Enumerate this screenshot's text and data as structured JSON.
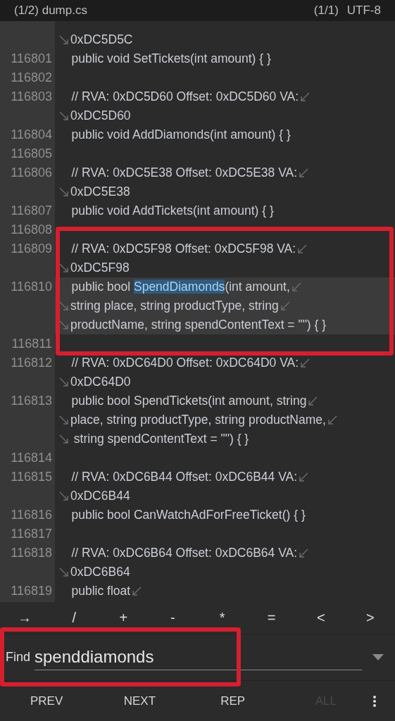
{
  "title_bar": {
    "file": "(1/2) dump.cs",
    "position": "(1/1)",
    "encoding": "UTF-8"
  },
  "lines": [
    {
      "continued": true,
      "wraps": false,
      "current": false,
      "segments": [
        {
          "text": "0xDC5D5C",
          "match": false
        }
      ]
    },
    {
      "number": "116801",
      "continued": false,
      "wraps": false,
      "current": false,
      "segments": [
        {
          "text": "    public void SetTickets(int amount) { }",
          "match": false
        }
      ]
    },
    {
      "number": "116802",
      "continued": false,
      "wraps": false,
      "current": false
    },
    {
      "number": "116803",
      "continued": false,
      "wraps": true,
      "current": false,
      "segments": [
        {
          "text": "    // RVA: 0xDC5D60 Offset: 0xDC5D60 VA:",
          "match": false
        }
      ]
    },
    {
      "continued": true,
      "wraps": false,
      "current": false,
      "segments": [
        {
          "text": "0xDC5D60",
          "match": false
        }
      ]
    },
    {
      "number": "116804",
      "continued": false,
      "wraps": false,
      "current": false,
      "segments": [
        {
          "text": "    public void AddDiamonds(int amount) { }",
          "match": false
        }
      ]
    },
    {
      "number": "116805",
      "continued": false,
      "wraps": false,
      "current": false
    },
    {
      "number": "116806",
      "continued": false,
      "wraps": true,
      "current": false,
      "segments": [
        {
          "text": "    // RVA: 0xDC5E38 Offset: 0xDC5E38 VA:",
          "match": false
        }
      ]
    },
    {
      "continued": true,
      "wraps": false,
      "current": false,
      "segments": [
        {
          "text": "0xDC5E38",
          "match": false
        }
      ]
    },
    {
      "number": "116807",
      "continued": false,
      "wraps": false,
      "current": false,
      "segments": [
        {
          "text": "    public void AddTickets(int amount) { }",
          "match": false
        }
      ]
    },
    {
      "number": "116808",
      "continued": false,
      "wraps": false,
      "current": false
    },
    {
      "number": "116809",
      "continued": false,
      "wraps": true,
      "current": false,
      "segments": [
        {
          "text": "    // RVA: 0xDC5F98 Offset: 0xDC5F98 VA:",
          "match": false
        }
      ]
    },
    {
      "continued": true,
      "wraps": false,
      "current": false,
      "segments": [
        {
          "text": "0xDC5F98",
          "match": false
        }
      ]
    },
    {
      "number": "116810",
      "continued": false,
      "wraps": true,
      "current": true,
      "segments": [
        {
          "text": "    public bool ",
          "match": false
        },
        {
          "text": "SpendDiamonds",
          "match": true
        },
        {
          "text": "(int amount,",
          "match": false
        }
      ]
    },
    {
      "continued": true,
      "wraps": true,
      "current": true,
      "segments": [
        {
          "text": "string place, string productType, string",
          "match": false
        }
      ]
    },
    {
      "continued": true,
      "wraps": false,
      "current": true,
      "segments": [
        {
          "text": "productName, string spendContentText = \"\") { }",
          "match": false
        }
      ]
    },
    {
      "number": "116811",
      "continued": false,
      "wraps": false,
      "current": false
    },
    {
      "number": "116812",
      "continued": false,
      "wraps": true,
      "current": false,
      "segments": [
        {
          "text": "    // RVA: 0xDC64D0 Offset: 0xDC64D0 VA:",
          "match": false
        }
      ]
    },
    {
      "continued": true,
      "wraps": false,
      "current": false,
      "segments": [
        {
          "text": "0xDC64D0",
          "match": false
        }
      ]
    },
    {
      "number": "116813",
      "continued": false,
      "wraps": true,
      "current": false,
      "segments": [
        {
          "text": "    public bool SpendTickets(int amount, string",
          "match": false
        }
      ]
    },
    {
      "continued": true,
      "wraps": true,
      "current": false,
      "segments": [
        {
          "text": "place, string productType, string productName,",
          "match": false
        }
      ]
    },
    {
      "continued": true,
      "wraps": false,
      "current": false,
      "segments": [
        {
          "text": " string spendContentText = \"\") { }",
          "match": false
        }
      ]
    },
    {
      "number": "116814",
      "continued": false,
      "wraps": false,
      "current": false
    },
    {
      "number": "116815",
      "continued": false,
      "wraps": true,
      "current": false,
      "segments": [
        {
          "text": "    // RVA: 0xDC6B44 Offset: 0xDC6B44 VA:",
          "match": false
        }
      ]
    },
    {
      "continued": true,
      "wraps": false,
      "current": false,
      "segments": [
        {
          "text": "0xDC6B44",
          "match": false
        }
      ]
    },
    {
      "number": "116816",
      "continued": false,
      "wraps": false,
      "current": false,
      "segments": [
        {
          "text": "    public bool CanWatchAdForFreeTicket() { }",
          "match": false
        }
      ]
    },
    {
      "number": "116817",
      "continued": false,
      "wraps": false,
      "current": false
    },
    {
      "number": "116818",
      "continued": false,
      "wraps": true,
      "current": false,
      "segments": [
        {
          "text": "    // RVA: 0xDC6B64 Offset: 0xDC6B64 VA:",
          "match": false
        }
      ]
    },
    {
      "continued": true,
      "wraps": false,
      "current": false,
      "segments": [
        {
          "text": "0xDC6B64",
          "match": false
        }
      ]
    },
    {
      "number": "116819",
      "continued": false,
      "wraps": true,
      "current": false,
      "segments": [
        {
          "text": "    public float",
          "match": false
        }
      ]
    }
  ],
  "symbol_keys": [
    "→",
    "/",
    "+",
    "-",
    "*",
    "=",
    "<",
    ">"
  ],
  "find": {
    "label": "Find",
    "value": "spenddiamonds"
  },
  "buttons": [
    {
      "label": "PREV",
      "disabled": false
    },
    {
      "label": "NEXT",
      "disabled": false
    },
    {
      "label": "REP",
      "disabled": false
    },
    {
      "label": "ALL",
      "disabled": true
    }
  ]
}
